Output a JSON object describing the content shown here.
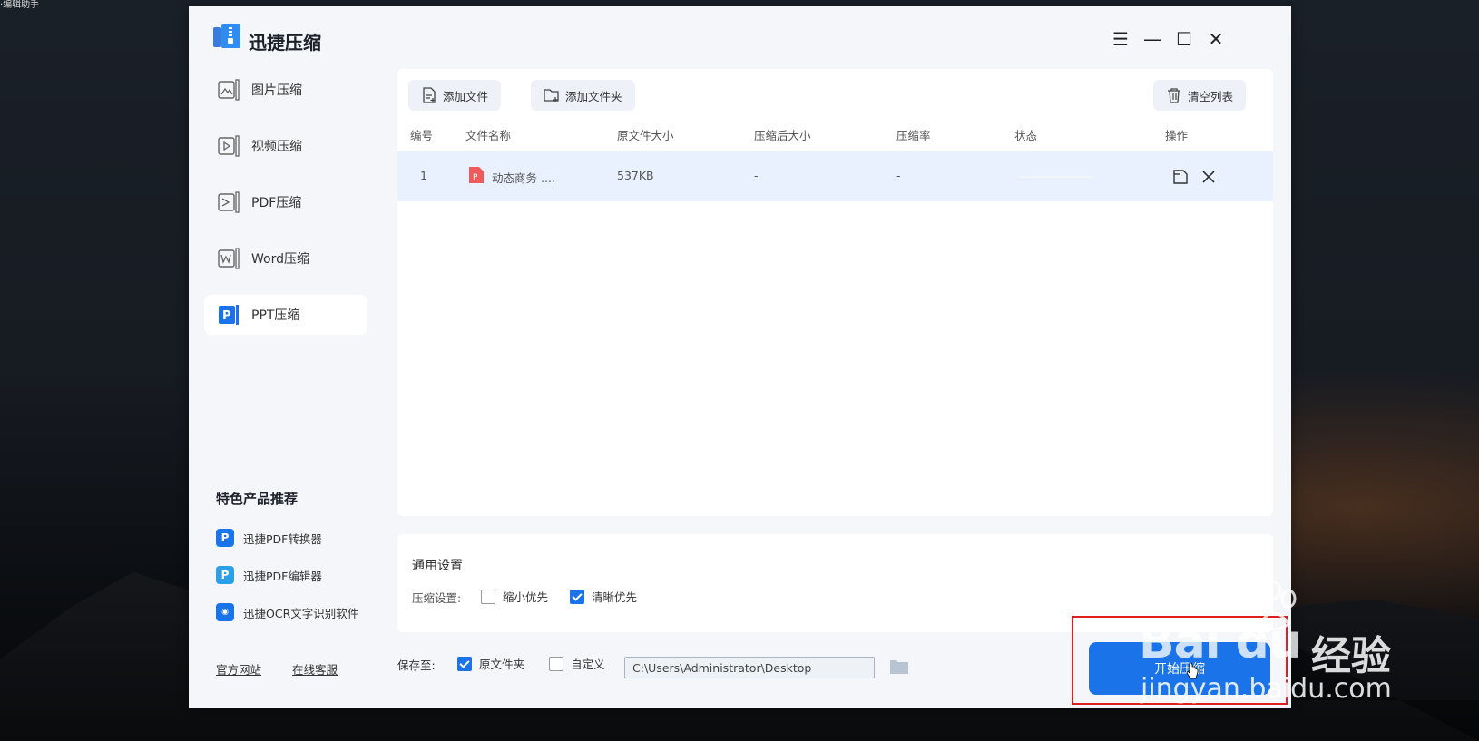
{
  "desktop": {
    "corner_label": "·编辑助手"
  },
  "app": {
    "title": "迅捷压缩"
  },
  "window_controls": {
    "menu": "☰",
    "minimize": "—",
    "maximize": "☐",
    "close": "✕"
  },
  "sidebar": {
    "items": [
      {
        "label": "图片压缩",
        "active": false
      },
      {
        "label": "视频压缩",
        "active": false
      },
      {
        "label": "PDF压缩",
        "active": false
      },
      {
        "label": "Word压缩",
        "active": false
      },
      {
        "label": "PPT压缩",
        "active": true
      }
    ]
  },
  "promo": {
    "title": "特色产品推荐",
    "items": [
      {
        "label": "迅捷PDF转换器",
        "color": "#1a73e8"
      },
      {
        "label": "迅捷PDF编辑器",
        "color": "#2ba0e8"
      },
      {
        "label": "迅捷OCR文字识别软件",
        "color": "#1a73e8"
      }
    ]
  },
  "footer": {
    "website": "官方网站",
    "support": "在线客服"
  },
  "toolbar": {
    "add_file": "添加文件",
    "add_folder": "添加文件夹",
    "clear_list": "清空列表"
  },
  "table": {
    "headers": [
      "编号",
      "文件名称",
      "原文件大小",
      "压缩后大小",
      "压缩率",
      "状态",
      "操作"
    ],
    "rows": [
      {
        "no": "1",
        "name": "动态商务 ....",
        "size": "537KB",
        "compressed": "-",
        "ratio": "-",
        "status": ""
      }
    ]
  },
  "settings": {
    "title": "通用设置",
    "label": "压缩设置:",
    "opt_small": "缩小优先",
    "opt_small_checked": false,
    "opt_clear": "清晰优先",
    "opt_clear_checked": true
  },
  "save": {
    "label": "保存至:",
    "opt_original": "原文件夹",
    "opt_original_checked": true,
    "opt_custom": "自定义",
    "opt_custom_checked": false,
    "path": "C:\\Users\\Administrator\\Desktop"
  },
  "start_button": "开始压缩",
  "watermark": {
    "brand": "Bai du",
    "cn": "经验",
    "url": "jingyan.baidu.com"
  },
  "colors": {
    "accent": "#1a73e8",
    "ppt": "#f05a5a",
    "highlight": "#e02020"
  }
}
